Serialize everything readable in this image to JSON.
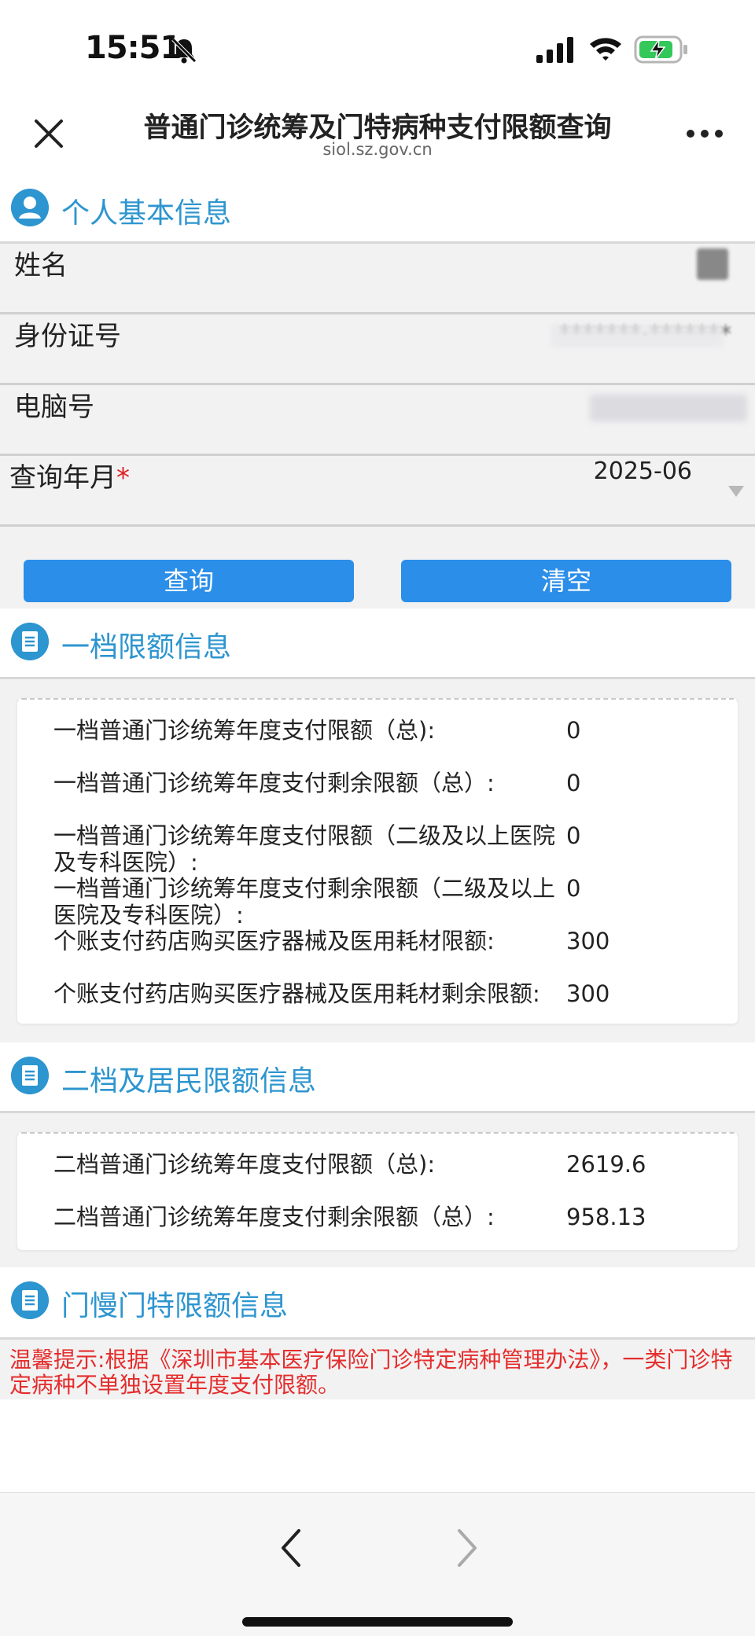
{
  "status_bar": {
    "time": "15:51",
    "icons": [
      "bell-slash-icon",
      "cellular-signal-icon",
      "wifi-icon",
      "battery-charging-icon"
    ]
  },
  "nav": {
    "title": "普通门诊统筹及门特病种支付限额查询",
    "subtitle": "siol.sz.gov.cn",
    "close_icon": "close-icon",
    "more_icon": "more-icon"
  },
  "personal": {
    "section_title": "个人基本信息",
    "name_label": "姓名",
    "id_label": "身份证号",
    "id_value": "*******·*******",
    "computer_no_label": "电脑号",
    "query_month_label": "查询年月",
    "required_mark": "*",
    "query_month_value": "2025-06"
  },
  "buttons": {
    "query": "查询",
    "clear": "清空"
  },
  "tier1": {
    "section_title": "一档限额信息",
    "rows": [
      {
        "label": "一档普通门诊统筹年度支付限额（总):",
        "value": "0"
      },
      {
        "label": "一档普通门诊统筹年度支付剩余限额（总）:",
        "value": "0"
      },
      {
        "label": "一档普通门诊统筹年度支付限额（二级及以上医院及专科医院）:",
        "value": "0"
      },
      {
        "label": "一档普通门诊统筹年度支付剩余限额（二级及以上医院及专科医院）:",
        "value": "0"
      },
      {
        "label": "个账支付药店购买医疗器械及医用耗材限额:",
        "value": "300"
      },
      {
        "label": "个账支付药店购买医疗器械及医用耗材剩余限额:",
        "value": "300"
      }
    ]
  },
  "tier2": {
    "section_title": "二档及居民限额信息",
    "rows": [
      {
        "label": "二档普通门诊统筹年度支付限额（总):",
        "value": "2619.6"
      },
      {
        "label": "二档普通门诊统筹年度支付剩余限额（总）:",
        "value": "958.13"
      }
    ]
  },
  "special": {
    "section_title": "门慢门特限额信息",
    "notice": "温馨提示:根据《深圳市基本医疗保险门诊特定病种管理办法》，一类门诊特定病种不单独设置年度支付限额。"
  },
  "toolbar": {
    "back_icon": "chevron-left-icon",
    "forward_icon": "chevron-right-icon"
  }
}
